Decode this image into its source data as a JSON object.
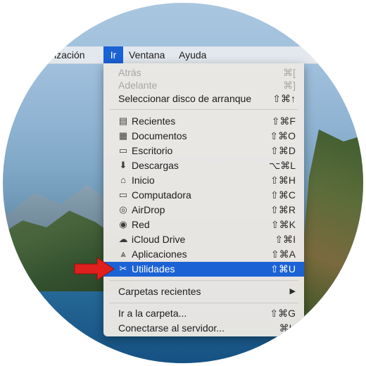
{
  "menubar": {
    "items": [
      {
        "label": "ización",
        "active": false
      },
      {
        "label": "Ir",
        "active": true
      },
      {
        "label": "Ventana",
        "active": false
      },
      {
        "label": "Ayuda",
        "active": false
      }
    ]
  },
  "menu": {
    "items": [
      {
        "label": "Atrás",
        "shortcut": "⌘[",
        "disabled": true
      },
      {
        "label": "Adelante",
        "shortcut": "⌘]",
        "disabled": true
      },
      {
        "label": "Seleccionar disco de arranque",
        "shortcut": "⇧⌘↑",
        "disabled": false
      },
      {
        "label": "Recientes",
        "icon": "recents-icon",
        "shortcut": "⇧⌘F"
      },
      {
        "label": "Documentos",
        "icon": "documents-icon",
        "shortcut": "⇧⌘O"
      },
      {
        "label": "Escritorio",
        "icon": "desktop-icon",
        "shortcut": "⇧⌘D"
      },
      {
        "label": "Descargas",
        "icon": "downloads-icon",
        "shortcut": "⌥⌘L"
      },
      {
        "label": "Inicio",
        "icon": "home-icon",
        "shortcut": "⇧⌘H"
      },
      {
        "label": "Computadora",
        "icon": "computer-icon",
        "shortcut": "⇧⌘C"
      },
      {
        "label": "AirDrop",
        "icon": "airdrop-icon",
        "shortcut": "⇧⌘R"
      },
      {
        "label": "Red",
        "icon": "network-icon",
        "shortcut": "⇧⌘K"
      },
      {
        "label": "iCloud Drive",
        "icon": "icloud-icon",
        "shortcut": "⇧⌘I"
      },
      {
        "label": "Aplicaciones",
        "icon": "applications-icon",
        "shortcut": "⇧⌘A"
      },
      {
        "label": "Utilidades",
        "icon": "utilities-icon",
        "shortcut": "⇧⌘U",
        "selected": true
      },
      {
        "label": "Carpetas recientes",
        "shortcut": "▶"
      },
      {
        "label": "Ir a la carpeta...",
        "shortcut": "⇧⌘G"
      },
      {
        "label": "Conectarse al servidor...",
        "shortcut": "⌘K"
      }
    ]
  },
  "colors": {
    "selection": "#1b62d5",
    "arrow": "#e0201d"
  }
}
